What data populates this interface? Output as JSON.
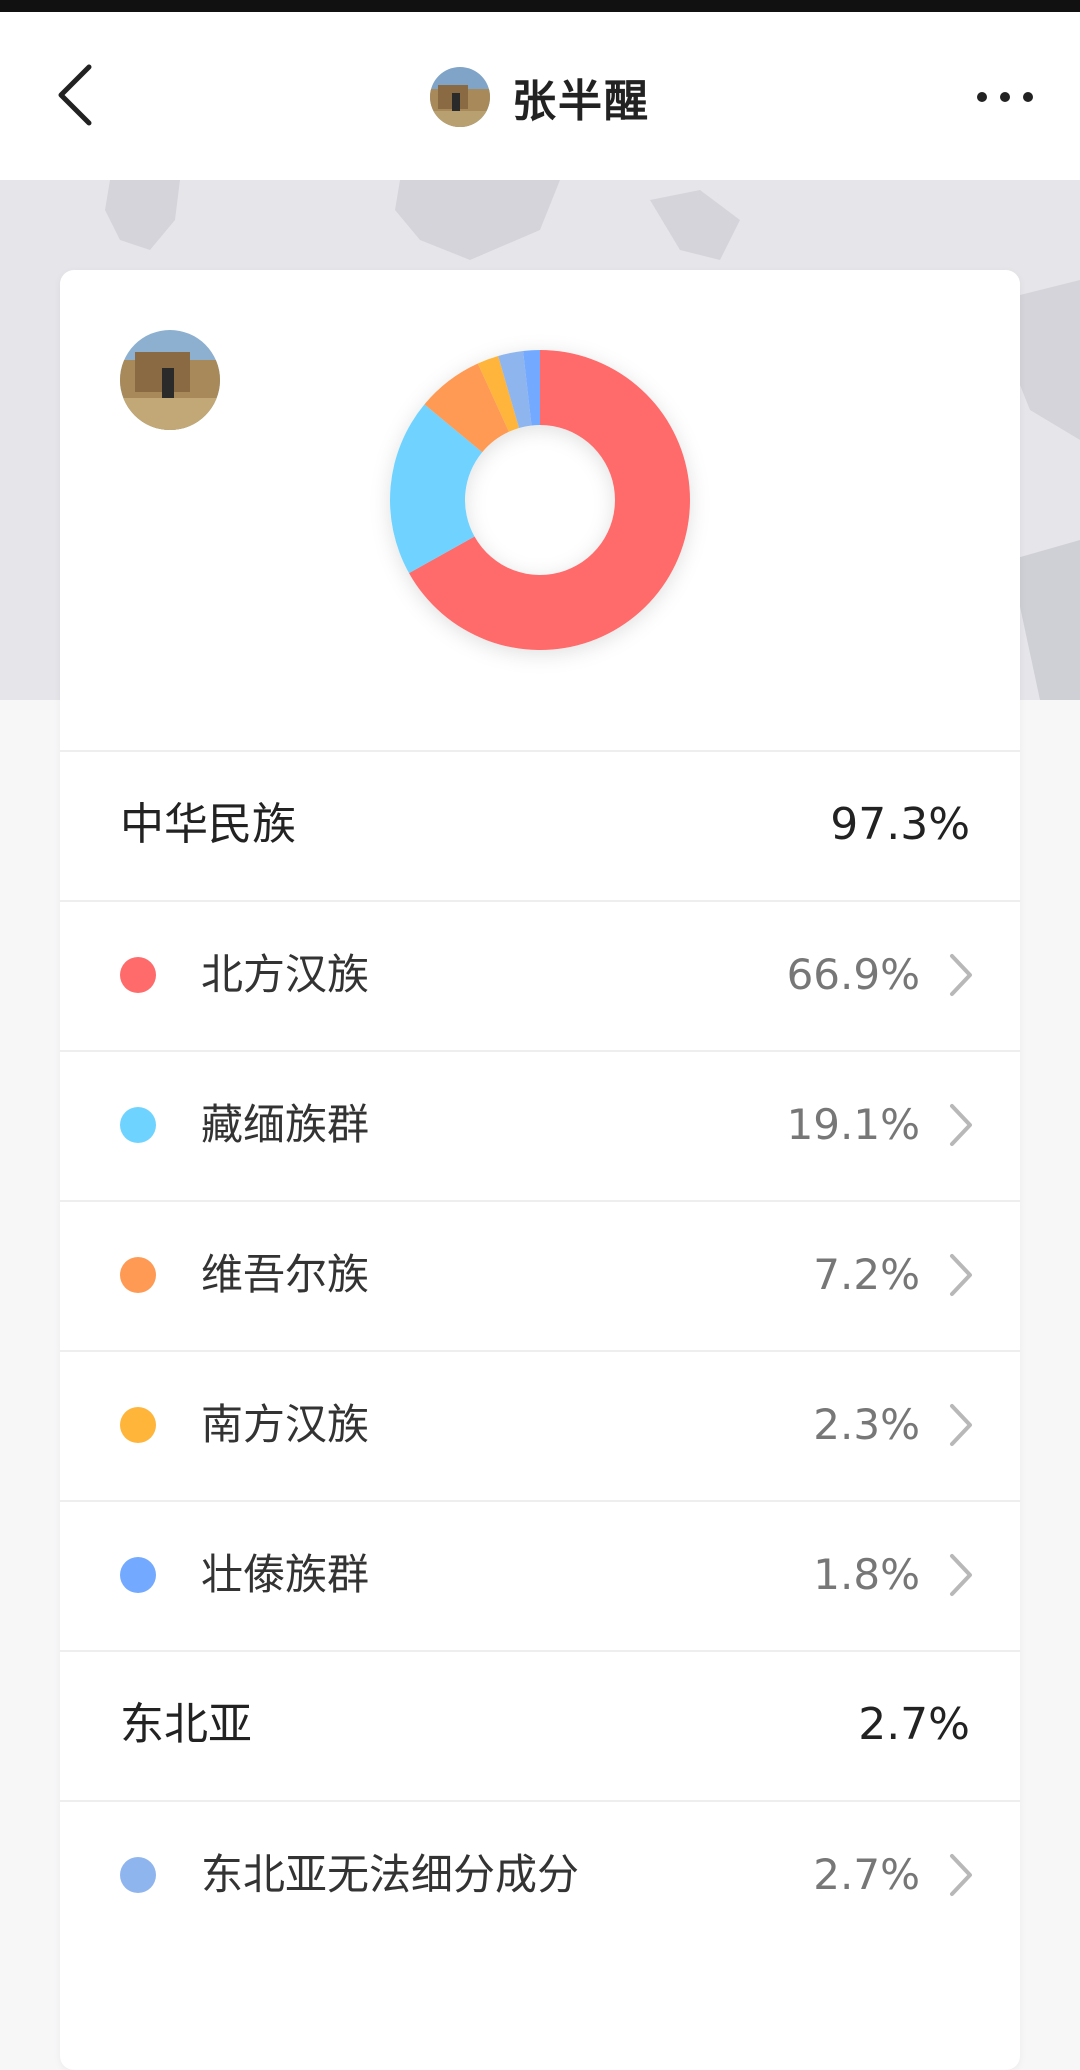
{
  "header": {
    "title": "张半醒",
    "back_icon": "chevron-left-icon",
    "more_icon": "more-horizontal-icon"
  },
  "chart_data": {
    "type": "pie",
    "style": "donut",
    "categories": [
      "北方汉族",
      "藏缅族群",
      "维吾尔族",
      "南方汉族",
      "壮傣族群",
      "东北亚无法细分成分"
    ],
    "values": [
      66.9,
      19.1,
      7.2,
      2.3,
      1.8,
      2.7
    ],
    "colors": [
      "#ff6b6b",
      "#6fd3ff",
      "#ff9a55",
      "#ffb43a",
      "#73a9ff",
      "#8fb5ef"
    ]
  },
  "sections": [
    {
      "name": "中华民族",
      "percent": "97.3%",
      "items": [
        {
          "name": "北方汉族",
          "percent": "66.9%",
          "color": "#ff6b6b"
        },
        {
          "name": "藏缅族群",
          "percent": "19.1%",
          "color": "#6fd3ff"
        },
        {
          "name": "维吾尔族",
          "percent": "7.2%",
          "color": "#ff9a55"
        },
        {
          "name": "南方汉族",
          "percent": "2.3%",
          "color": "#ffb43a"
        },
        {
          "name": "壮傣族群",
          "percent": "1.8%",
          "color": "#73a9ff"
        }
      ]
    },
    {
      "name": "东北亚",
      "percent": "2.7%",
      "items": [
        {
          "name": "东北亚无法细分成分",
          "percent": "2.7%",
          "color": "#8fb5ef"
        }
      ]
    }
  ]
}
